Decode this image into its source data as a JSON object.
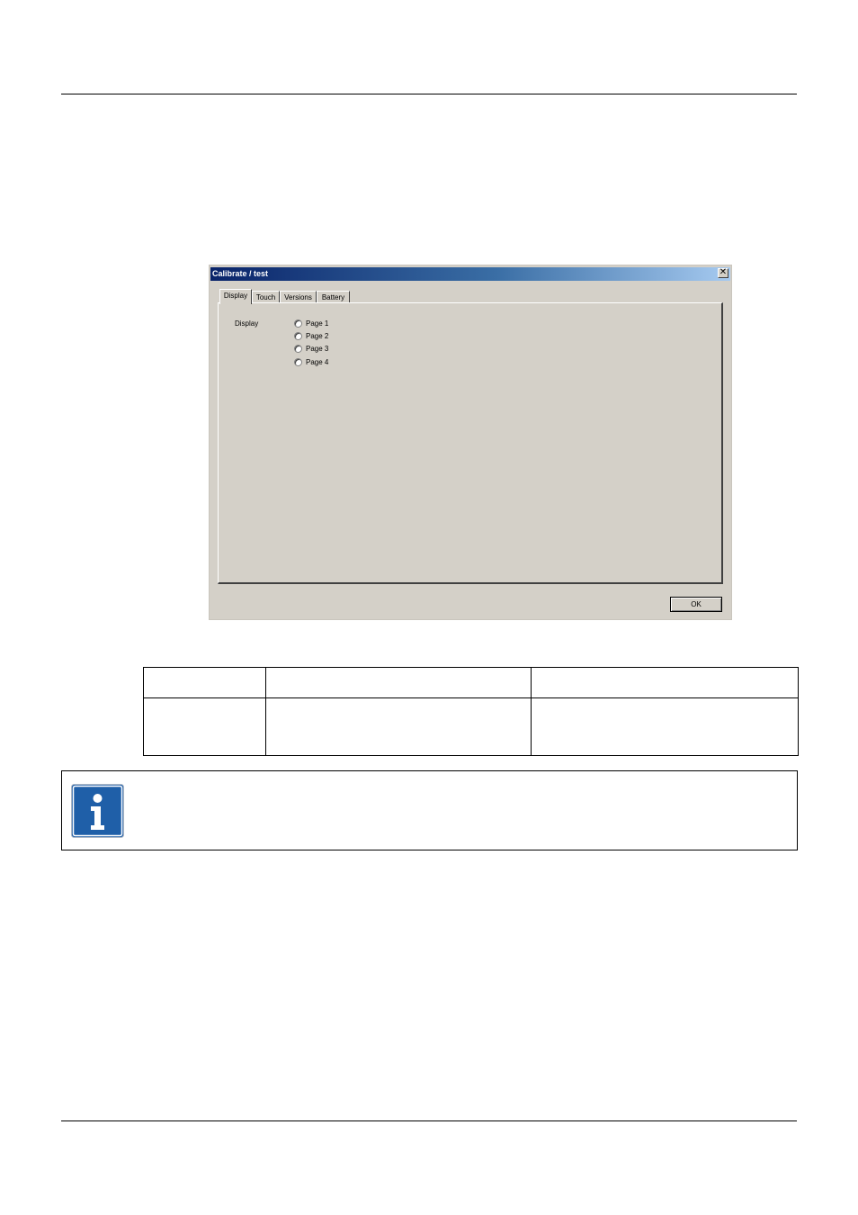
{
  "dialog": {
    "title": "Calibrate / test",
    "close_symbol": "✕",
    "tabs": [
      {
        "label": "Display",
        "active": true
      },
      {
        "label": "Touch",
        "active": false
      },
      {
        "label": "Versions",
        "active": false
      },
      {
        "label": "Battery",
        "active": false
      }
    ],
    "group_label": "Display",
    "radio_options": [
      {
        "label": "Page 1",
        "selected": false
      },
      {
        "label": "Page 2",
        "selected": false
      },
      {
        "label": "Page 3",
        "selected": false
      },
      {
        "label": "Page 4",
        "selected": false
      }
    ],
    "ok_label": "OK",
    "colors": {
      "titlebar_start": "#0a246a",
      "titlebar_end": "#a6caf0",
      "face": "#d4d0c8"
    }
  },
  "info_box": {
    "icon": "info-icon",
    "icon_color": "#1f5fa8"
  }
}
